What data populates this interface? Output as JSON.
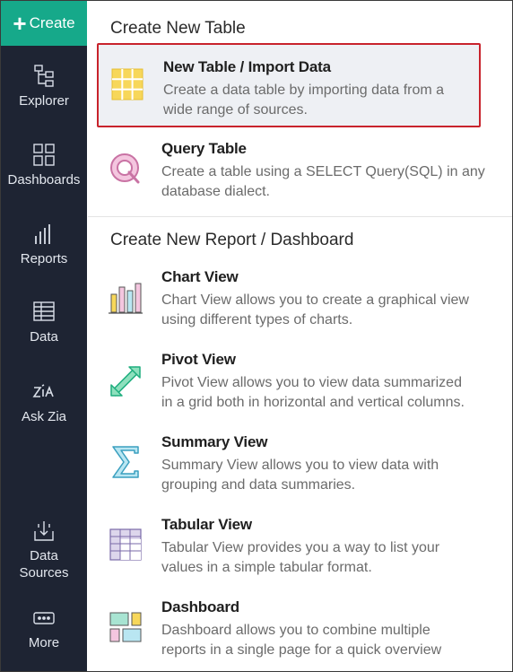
{
  "sidebar": {
    "create_label": "Create",
    "items": [
      {
        "label": "Explorer"
      },
      {
        "label": "Dashboards"
      },
      {
        "label": "Reports"
      },
      {
        "label": "Data"
      },
      {
        "label": "Ask Zia"
      },
      {
        "label_line1": "Data",
        "label_line2": "Sources"
      },
      {
        "label": "More"
      }
    ]
  },
  "sections": {
    "table": {
      "title": "Create New Table",
      "items": [
        {
          "title": "New Table / Import Data",
          "desc_line1": "Create a data table by importing data from a",
          "desc_line2": "wide range of sources.",
          "icon": "table-grid-icon"
        },
        {
          "title": "Query Table",
          "desc_line1": "Create a table using a SELECT Query(SQL) in any",
          "desc_line2": "database dialect.",
          "icon": "query-icon"
        }
      ]
    },
    "report": {
      "title": "Create New Report / Dashboard",
      "items": [
        {
          "title": "Chart View",
          "desc_line1": "Chart View allows you to create a graphical view",
          "desc_line2": "using different types of charts.",
          "icon": "bar-chart-icon"
        },
        {
          "title": "Pivot View",
          "desc_line1": "Pivot View allows you to view data summarized",
          "desc_line2": "in a grid both in horizontal and vertical columns.",
          "icon": "pivot-arrow-icon"
        },
        {
          "title": "Summary View",
          "desc_line1": "Summary View allows you to view data with",
          "desc_line2": "grouping and data summaries.",
          "icon": "sigma-icon"
        },
        {
          "title": "Tabular View",
          "desc_line1": "Tabular View provides you a way to list your",
          "desc_line2": "values in a simple tabular format.",
          "icon": "tabular-icon"
        },
        {
          "title": "Dashboard",
          "desc_line1": "Dashboard allows you to combine multiple",
          "desc_line2": "reports in a single page for a quick overview",
          "icon": "dashboard-tiles-icon"
        }
      ]
    }
  },
  "colors": {
    "sidebar_bg": "#1e2433",
    "create_bg": "#16a98a",
    "highlight_border": "#c8232c",
    "highlight_bg": "#eef0f4"
  }
}
